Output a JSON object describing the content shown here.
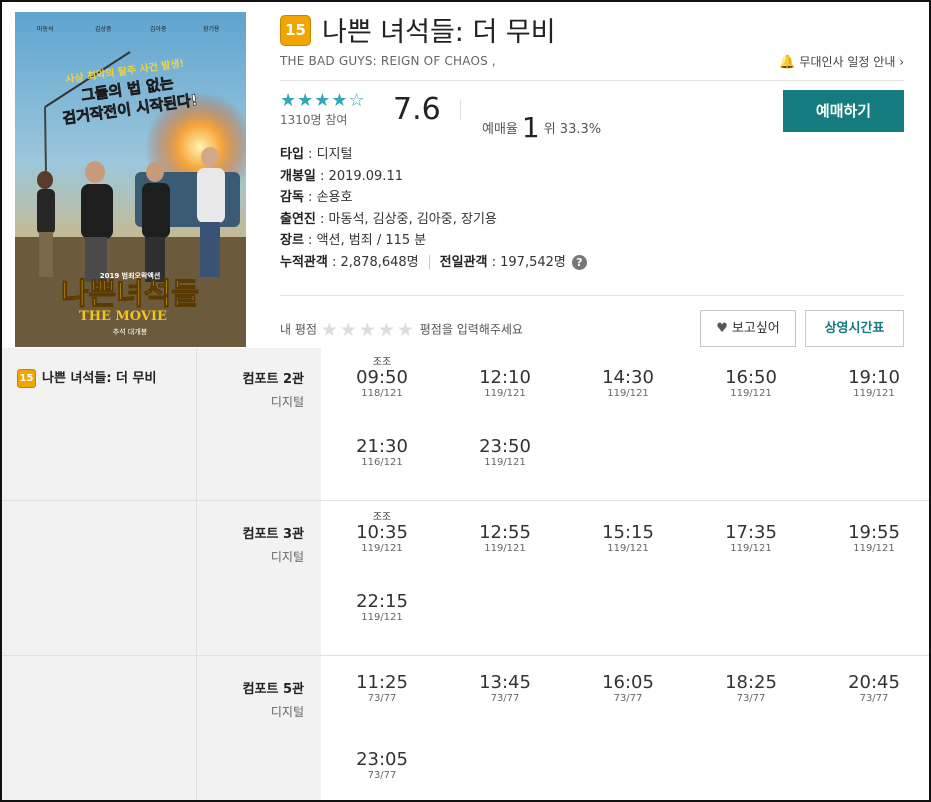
{
  "movie": {
    "age_rating": "15",
    "title": "나쁜 녀석들: 더 무비",
    "subtitle": "THE BAD GUYS: REIGN OF CHAOS ,",
    "notice": "무대인사 일정 안내",
    "notice_arrow": "›",
    "stars": "★★★★",
    "star_empty": "☆",
    "participants": "1310명 참여",
    "score": "7.6",
    "reserve_label": "예매율",
    "reserve_rank": "1",
    "reserve_rate": "위 33.3%",
    "book_label": "예매하기",
    "poster": {
      "top_names": [
        "마동석",
        "김상중",
        "김아중",
        "장기용"
      ],
      "tagline1": "사상 최악의 탈주 사건 발생!",
      "tagline2": "그들의 법 없는",
      "tagline3": "검거작전이 시작된다!",
      "small_note": "2019 범죄오락액션",
      "poster_title": "나쁜녀석들",
      "poster_subtitle": "THE MOVIE",
      "poster_release": "추석 대개봉"
    }
  },
  "details": {
    "type_label": "타입",
    "type": "디지털",
    "open_label": "개봉일",
    "open": "2019.09.11",
    "director_label": "감독",
    "director": "손용호",
    "cast_label": "출연진",
    "cast": "마동석, 김상중, 김아중, 장기용",
    "genre_label": "장르",
    "genre": "액션, 범죄 / 115 분",
    "total_label": "누적관객",
    "total": "2,878,648명",
    "prev_label": "전일관객",
    "prev": "197,542명",
    "help": "?"
  },
  "my_rating": {
    "label": "내 평점",
    "ghost_stars": "★★★★★",
    "hint": "평점을 입력해주세요"
  },
  "buttons": {
    "want": "보고싶어",
    "want_icon": "♥",
    "schedule": "상영시간표"
  },
  "schedule": {
    "movie_age": "15",
    "movie_title": "나쁜 녀석들: 더 무비",
    "halls": [
      {
        "name": "컴포트 2관",
        "type": "디지털",
        "slots": [
          {
            "tag": "조조",
            "time": "09:50",
            "seats": "118/121"
          },
          {
            "tag": "",
            "time": "12:10",
            "seats": "119/121"
          },
          {
            "tag": "",
            "time": "14:30",
            "seats": "119/121"
          },
          {
            "tag": "",
            "time": "16:50",
            "seats": "119/121"
          },
          {
            "tag": "",
            "time": "19:10",
            "seats": "119/121"
          },
          {
            "tag": "",
            "time": "21:30",
            "seats": "116/121"
          },
          {
            "tag": "",
            "time": "23:50",
            "seats": "119/121"
          }
        ]
      },
      {
        "name": "컴포트 3관",
        "type": "디지털",
        "slots": [
          {
            "tag": "조조",
            "time": "10:35",
            "seats": "119/121"
          },
          {
            "tag": "",
            "time": "12:55",
            "seats": "119/121"
          },
          {
            "tag": "",
            "time": "15:15",
            "seats": "119/121"
          },
          {
            "tag": "",
            "time": "17:35",
            "seats": "119/121"
          },
          {
            "tag": "",
            "time": "19:55",
            "seats": "119/121"
          },
          {
            "tag": "",
            "time": "22:15",
            "seats": "119/121"
          }
        ]
      },
      {
        "name": "컴포트 5관",
        "type": "디지털",
        "slots": [
          {
            "tag": "",
            "time": "11:25",
            "seats": "73/77"
          },
          {
            "tag": "",
            "time": "13:45",
            "seats": "73/77"
          },
          {
            "tag": "",
            "time": "16:05",
            "seats": "73/77"
          },
          {
            "tag": "",
            "time": "18:25",
            "seats": "73/77"
          },
          {
            "tag": "",
            "time": "20:45",
            "seats": "73/77"
          },
          {
            "tag": "",
            "time": "23:05",
            "seats": "73/77"
          }
        ]
      }
    ]
  }
}
